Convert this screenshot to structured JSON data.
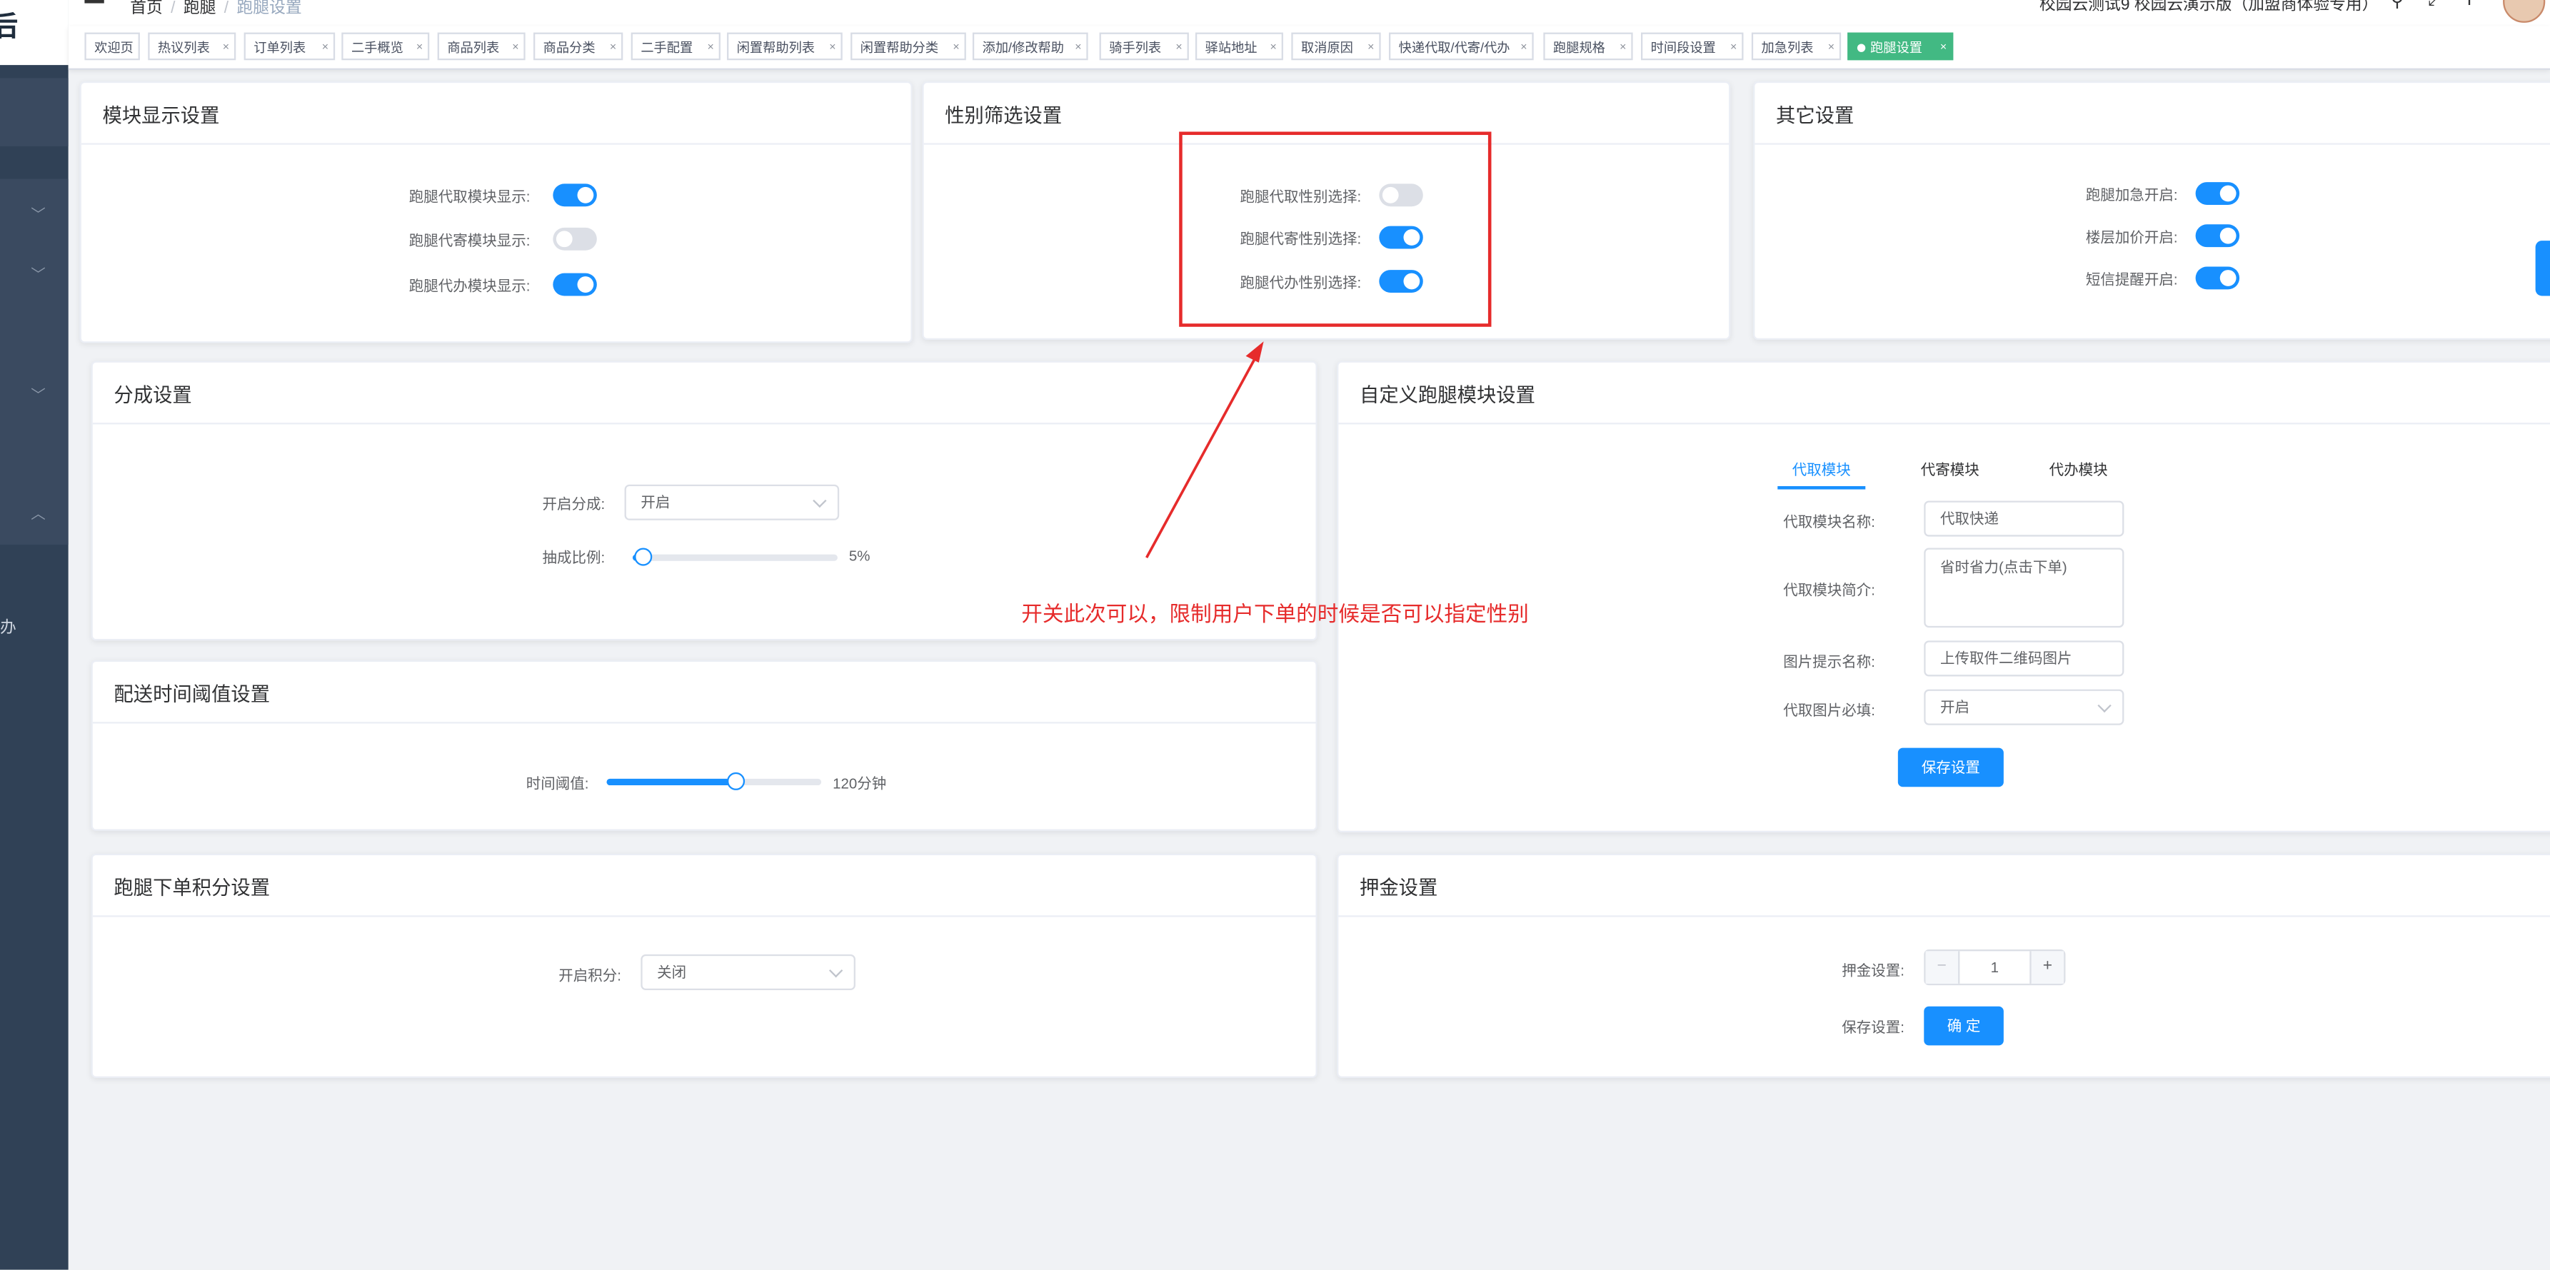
{
  "sidebar": {
    "logo_text": "后",
    "fragment_text": "办"
  },
  "header": {
    "breadcrumb": [
      "首页",
      "跑腿",
      "跑腿设置"
    ],
    "title": "校园云测试9 校园云演示版（加盟商体验专用）"
  },
  "tags": [
    {
      "label": "欢迎页"
    },
    {
      "label": "热议列表"
    },
    {
      "label": "订单列表"
    },
    {
      "label": "二手概览"
    },
    {
      "label": "商品列表"
    },
    {
      "label": "商品分类"
    },
    {
      "label": "二手配置"
    },
    {
      "label": "闲置帮助列表"
    },
    {
      "label": "闲置帮助分类"
    },
    {
      "label": "添加/修改帮助"
    },
    {
      "label": "骑手列表"
    },
    {
      "label": "驿站地址"
    },
    {
      "label": "取消原因"
    },
    {
      "label": "快递代取/代寄/代办"
    },
    {
      "label": "跑腿规格"
    },
    {
      "label": "时间段设置"
    },
    {
      "label": "加急列表"
    },
    {
      "label": "跑腿设置"
    }
  ],
  "module_display": {
    "title": "模块显示设置",
    "rows": [
      {
        "label": "跑腿代取模块显示:",
        "on": true
      },
      {
        "label": "跑腿代寄模块显示:",
        "on": false
      },
      {
        "label": "跑腿代办模块显示:",
        "on": true
      }
    ]
  },
  "gender_filter": {
    "title": "性别筛选设置",
    "rows": [
      {
        "label": "跑腿代取性别选择:",
        "on": false
      },
      {
        "label": "跑腿代寄性别选择:",
        "on": true
      },
      {
        "label": "跑腿代办性别选择:",
        "on": true
      }
    ]
  },
  "other_settings": {
    "title": "其它设置",
    "rows": [
      {
        "label": "跑腿加急开启:",
        "on": true
      },
      {
        "label": "楼层加价开启:",
        "on": true
      },
      {
        "label": "短信提醒开启:",
        "on": true
      }
    ]
  },
  "commission": {
    "title": "分成设置",
    "enable_label": "开启分成:",
    "enable_value": "开启",
    "ratio_label": "抽成比例:",
    "ratio_value": "5%",
    "ratio_fraction": 0.05
  },
  "delivery_threshold": {
    "title": "配送时间阈值设置",
    "label": "时间阈值:",
    "value": "120分钟",
    "fraction": 0.6
  },
  "points": {
    "title": "跑腿下单积分设置",
    "label": "开启积分:",
    "value": "关闭"
  },
  "custom_module": {
    "title": "自定义跑腿模块设置",
    "tabs": [
      "代取模块",
      "代寄模块",
      "代办模块"
    ],
    "name_label": "代取模块名称:",
    "name_value": "代取快递",
    "intro_label": "代取模块简介:",
    "intro_value": "省时省力(点击下单)",
    "image_hint_label": "图片提示名称:",
    "image_hint_value": "上传取件二维码图片",
    "image_required_label": "代取图片必填:",
    "image_required_value": "开启",
    "save_label": "保存设置"
  },
  "deposit": {
    "title": "押金设置",
    "label": "押金设置:",
    "stepper_minus": "−",
    "stepper_plus": "+",
    "value": "1",
    "save_label": "保存设置:",
    "confirm_label": "确 定"
  },
  "annotation": {
    "text": "开关此次可以，限制用户下单的时候是否可以指定性别",
    "color": "#e62b2b"
  },
  "colors": {
    "accent": "#1890ff",
    "active_tag": "#42b983",
    "sidebar": "#304156"
  }
}
